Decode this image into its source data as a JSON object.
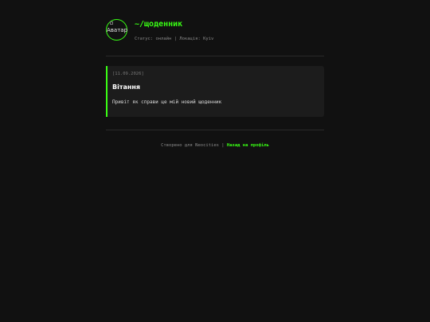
{
  "header": {
    "avatar_alt": "Аватар",
    "title": "~/щоденник",
    "status": "Статус: онлайн | Локація: Kyiv"
  },
  "entries": [
    {
      "date": "[11.09.2026]",
      "title": "Вітання",
      "text": "Привіт як справи це мій новий щоденник"
    }
  ],
  "footer": {
    "credit": "Створено для Neocities",
    "separator": "|",
    "back_link": "Назад на профіль"
  },
  "colors": {
    "background": "#111111",
    "accent": "#39ff14",
    "card": "#1c1c1c"
  }
}
